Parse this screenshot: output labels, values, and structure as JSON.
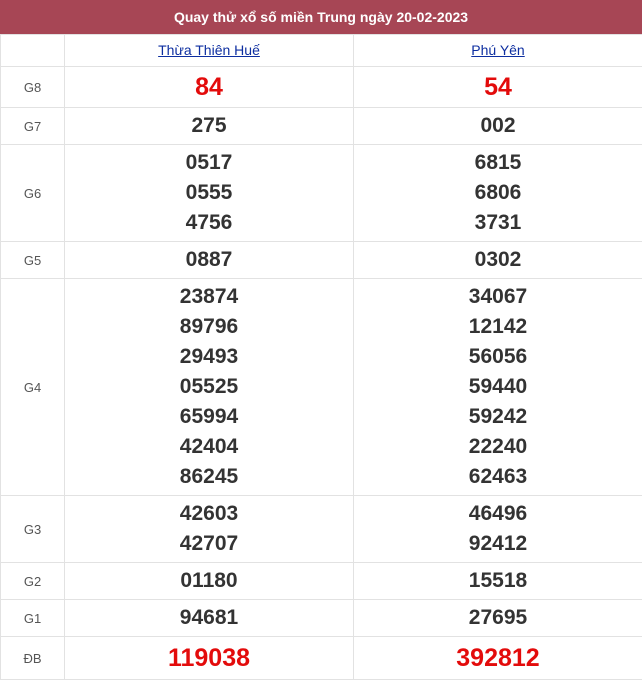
{
  "header": {
    "title": "Quay thử xổ số miền Trung ngày 20-02-2023"
  },
  "columns": [
    {
      "name": "Thừa Thiên Huế"
    },
    {
      "name": "Phú Yên"
    }
  ],
  "prizes": {
    "g8": {
      "label": "G8",
      "values": [
        [
          "84"
        ],
        [
          "54"
        ]
      ]
    },
    "g7": {
      "label": "G7",
      "values": [
        [
          "275"
        ],
        [
          "002"
        ]
      ]
    },
    "g6": {
      "label": "G6",
      "values": [
        [
          "0517",
          "0555",
          "4756"
        ],
        [
          "6815",
          "6806",
          "3731"
        ]
      ]
    },
    "g5": {
      "label": "G5",
      "values": [
        [
          "0887"
        ],
        [
          "0302"
        ]
      ]
    },
    "g4": {
      "label": "G4",
      "values": [
        [
          "23874",
          "89796",
          "29493",
          "05525",
          "65994",
          "42404",
          "86245"
        ],
        [
          "34067",
          "12142",
          "56056",
          "59440",
          "59242",
          "22240",
          "62463"
        ]
      ]
    },
    "g3": {
      "label": "G3",
      "values": [
        [
          "42603",
          "42707"
        ],
        [
          "46496",
          "92412"
        ]
      ]
    },
    "g2": {
      "label": "G2",
      "values": [
        [
          "01180"
        ],
        [
          "15518"
        ]
      ]
    },
    "g1": {
      "label": "G1",
      "values": [
        [
          "94681"
        ],
        [
          "27695"
        ]
      ]
    },
    "db": {
      "label": "ĐB",
      "values": [
        [
          "119038"
        ],
        [
          "392812"
        ]
      ]
    }
  },
  "colors": {
    "header_bg": "#a74655",
    "accent_red": "#e30b0b",
    "link": "#0d2ea0"
  }
}
